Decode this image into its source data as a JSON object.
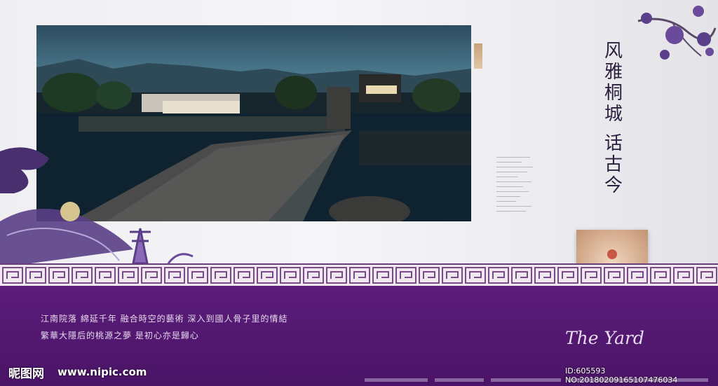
{
  "heading": {
    "line1": [
      "风",
      "雅",
      "桐",
      "城"
    ],
    "line2": [
      "话",
      "古",
      "今"
    ]
  },
  "side_badge_text": "",
  "body_text": {
    "line1": "江南院落  綿延千年  融合時空的藝術  深入到國人骨子里的情結",
    "line2": "繁華大隱后的桃源之夢  是初心亦是歸心"
  },
  "script_title": "The Yard",
  "watermark": {
    "logo": "昵图网",
    "url": "www.nipic.com"
  },
  "image_id": "ID:605593 NO:20180209165107476034",
  "colors": {
    "purple": "#4f166c",
    "border": "#6b3d7b",
    "gold": "#d6ad8f"
  }
}
